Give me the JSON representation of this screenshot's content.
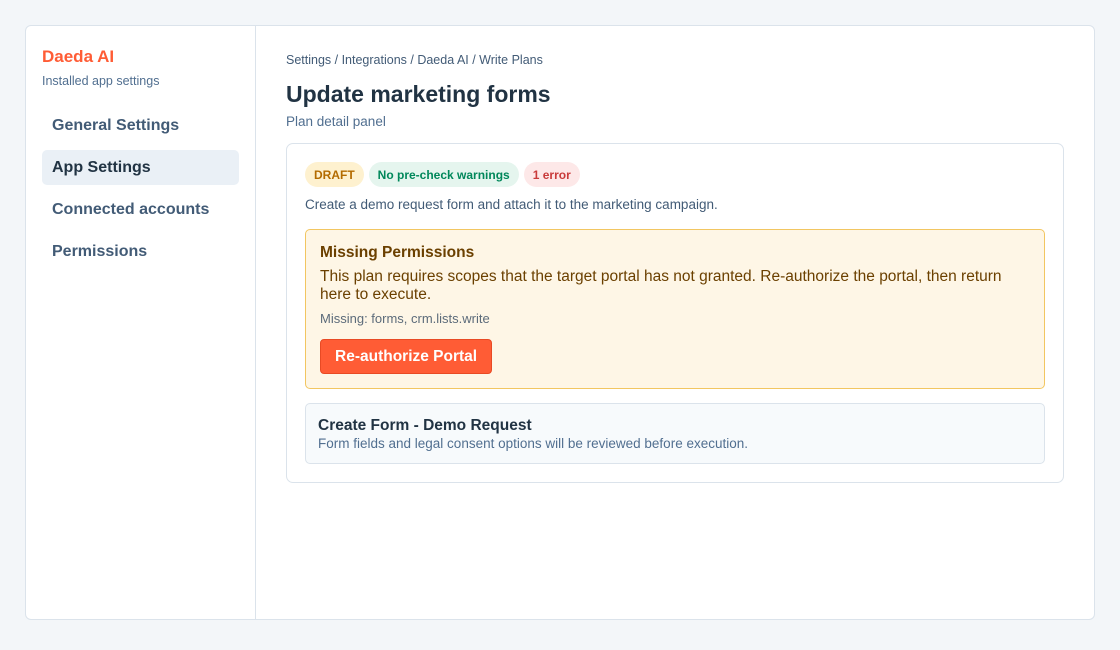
{
  "sidebar": {
    "brand": "Daeda AI",
    "subtitle": "Installed app settings",
    "items": [
      {
        "label": "General Settings",
        "active": false
      },
      {
        "label": "App Settings",
        "active": true
      },
      {
        "label": "Connected accounts",
        "active": false
      },
      {
        "label": "Permissions",
        "active": false
      }
    ]
  },
  "main": {
    "breadcrumb": "Settings / Integrations / Daeda AI / Write Plans",
    "title": "Update marketing forms",
    "subtitle": "Plan detail panel",
    "plan": {
      "badges": {
        "status": "DRAFT",
        "warnings": "No pre-check warnings",
        "errors": "1 error"
      },
      "description": "Create a demo request form and attach it to the marketing campaign.",
      "alert": {
        "title": "Missing Permissions",
        "body": "This plan requires scopes that the target portal has not granted. Re-authorize the portal, then return here to execute.",
        "missing": "Missing: forms, crm.lists.write",
        "button_label": "Re-authorize Portal"
      },
      "step": {
        "title": "Create Form - Demo Request",
        "description": "Form fields and legal consent options will be reviewed before execution."
      }
    }
  },
  "colors": {
    "accent": "#ff5c35",
    "draft_bg": "#fef1cf",
    "ok_bg": "#e5f5ee",
    "error_bg": "#fde8e8",
    "alert_bg": "#fef6e6"
  }
}
